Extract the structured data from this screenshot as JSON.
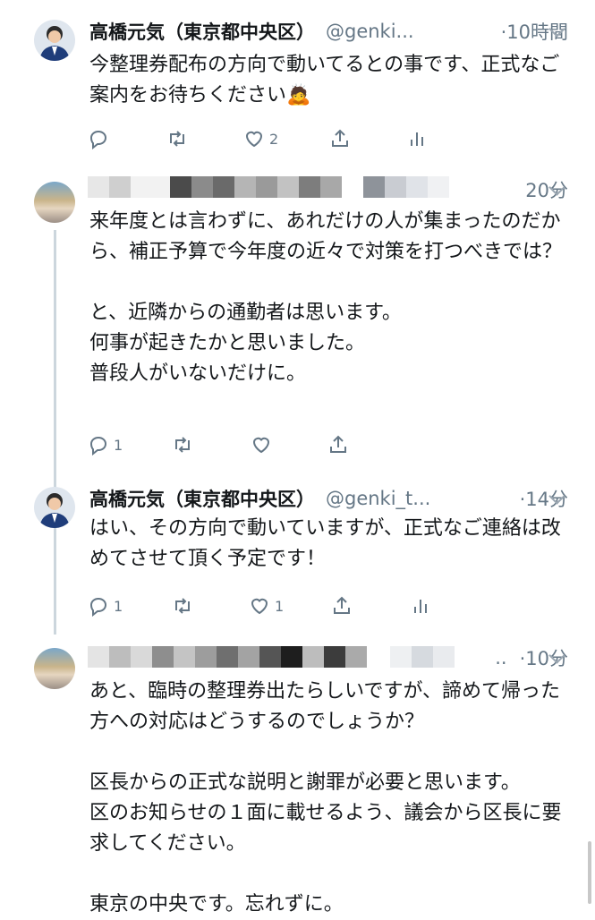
{
  "tweets": [
    {
      "name": "高橋元気（東京都中央区）",
      "handle": "@genki...",
      "time": "·10時間",
      "text": "今整理券配布の方向で動いてるとの事です、正式なご案内をお待ちください🙇",
      "reply_count": "",
      "like_count": "2"
    },
    {
      "name": "",
      "handle": "",
      "time": "20分",
      "text": "来年度とは言わずに、あれだけの人が集まったのだから、補正予算で今年度の近々で対策を打つべきでは？\n\nと、近隣からの通勤者は思います。\n何事が起きたかと思いました。\n普段人がいないだけに。",
      "reply_count": "1",
      "like_count": ""
    },
    {
      "name": "高橋元気（東京都中央区）",
      "handle": "@genki_t...",
      "time": "·14分",
      "text": "はい、その方向で動いていますが、正式なご連絡は改めてさせて頂く予定です！",
      "reply_count": "1",
      "like_count": "1"
    },
    {
      "name": "",
      "handle": "..",
      "time": "·10分",
      "text": "あと、臨時の整理券出たらしいですが、諦めて帰った方への対応はどうするのでしょうか？\n\n区長からの正式な説明と謝罪が必要と思います。\n区のお知らせの１面に載せるよう、議会から区長に要求してください。\n\n東京の中央です。忘れずに。",
      "reply_count": "",
      "like_count": ""
    }
  ],
  "icons": [
    "reply-icon",
    "retweet-icon",
    "like-icon",
    "share-icon",
    "analytics-icon",
    "chevron-down-icon"
  ],
  "colors": {
    "text": "#14171a",
    "secondary": "#657786",
    "thread_line": "#ccd6dd"
  }
}
